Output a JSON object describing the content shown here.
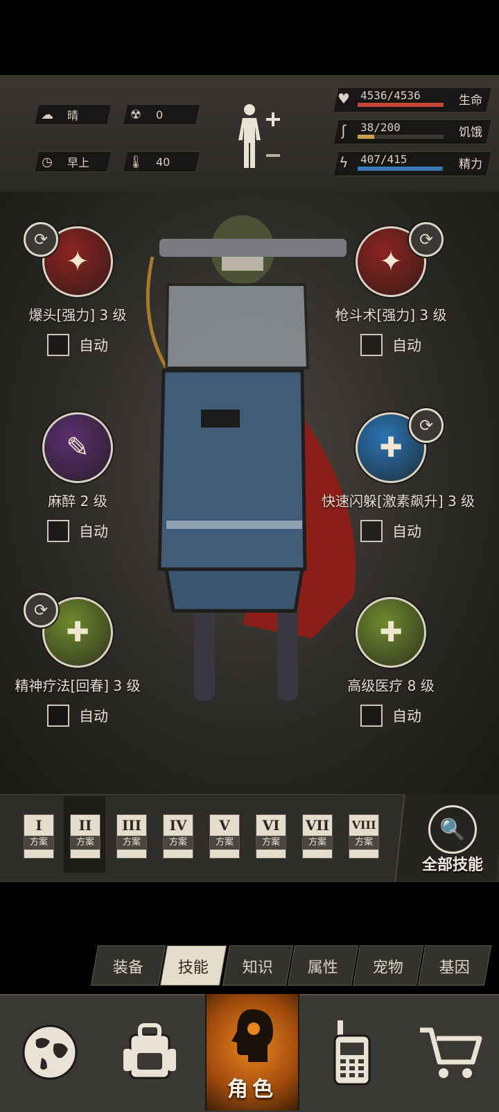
{
  "status": {
    "weather": {
      "icon": "cloud-sun-icon",
      "label": "晴"
    },
    "radiation": {
      "icon": "radiation-icon",
      "value": "0"
    },
    "time": {
      "icon": "clock-icon",
      "label": "早上"
    },
    "temperature": {
      "icon": "thermometer-icon",
      "value": "40"
    },
    "bars": [
      {
        "icon": "heart-pulse-icon",
        "value": "4536/4536",
        "label": "生命",
        "fraction": 1.0,
        "color": "#c4463a"
      },
      {
        "icon": "stomach-icon",
        "value": "38/200",
        "label": "饥饿",
        "fraction": 0.19,
        "color": "#c9a24a"
      },
      {
        "icon": "brain-bolt-icon",
        "value": "407/415",
        "label": "精力",
        "fraction": 0.98,
        "color": "#3b78b8"
      }
    ]
  },
  "skills": [
    {
      "name": "爆头[强力] 3 级",
      "auto": "自动",
      "icon": "headshot-icon",
      "color": "#8c2420",
      "swap": true
    },
    {
      "name": "枪斗术[强力] 3 级",
      "auto": "自动",
      "icon": "gunfight-icon",
      "color": "#8c2420",
      "swap": true
    },
    {
      "name": "麻醉 2 级",
      "auto": "自动",
      "icon": "syringe-icon",
      "color": "#5a2f6e",
      "swap": false
    },
    {
      "name": "快速闪躲[激素飙升] 3 级",
      "auto": "自动",
      "icon": "dodge-icon",
      "color": "#2a74b4",
      "swap": true
    },
    {
      "name": "精神疗法[回春] 3 级",
      "auto": "自动",
      "icon": "psych-heal-icon",
      "color": "#6e8a2e",
      "swap": true
    },
    {
      "name": "高级医疗 8 级",
      "auto": "自动",
      "icon": "medkit-icon",
      "color": "#6e8a2e",
      "swap": false
    }
  ],
  "plans": [
    {
      "num": "I",
      "label": "方案"
    },
    {
      "num": "II",
      "label": "方案"
    },
    {
      "num": "III",
      "label": "方案"
    },
    {
      "num": "IV",
      "label": "方案"
    },
    {
      "num": "V",
      "label": "方案"
    },
    {
      "num": "VI",
      "label": "方案"
    },
    {
      "num": "VII",
      "label": "方案"
    },
    {
      "num": "VIII",
      "label": "方案"
    }
  ],
  "active_plan": "II",
  "all_skills": "全部技能",
  "tabs": [
    "装备",
    "技能",
    "知识",
    "属性",
    "宠物",
    "基因"
  ],
  "active_tab": "技能",
  "nav": {
    "character_label": "角色"
  }
}
